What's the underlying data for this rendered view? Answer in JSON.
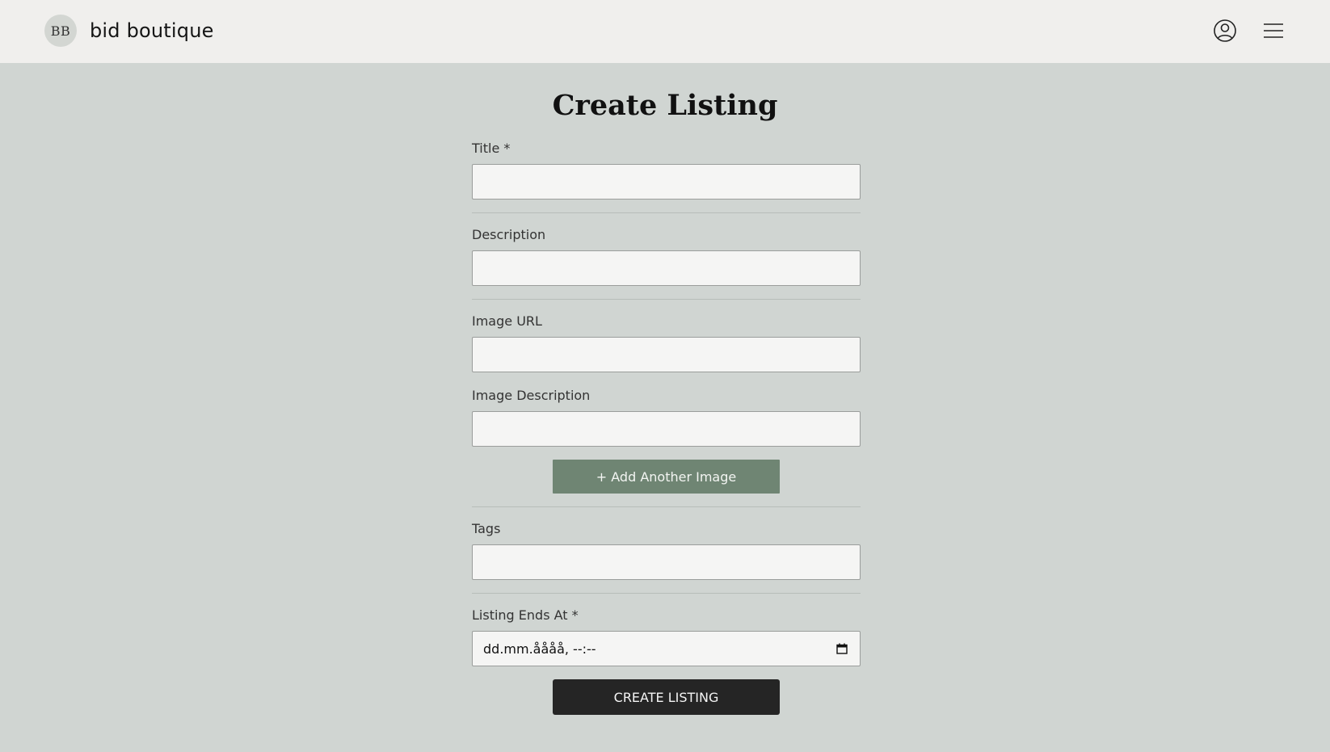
{
  "header": {
    "logo_text": "BB",
    "brand_name": "bid boutique",
    "user_icon": "user-circle-icon",
    "menu_icon": "hamburger-menu-icon"
  },
  "page": {
    "title": "Create Listing"
  },
  "form": {
    "title_label": "Title *",
    "title_value": "",
    "description_label": "Description",
    "description_value": "",
    "image_url_label": "Image URL",
    "image_url_value": "",
    "image_description_label": "Image Description",
    "image_description_value": "",
    "add_image_label": "+ Add Another Image",
    "tags_label": "Tags",
    "tags_value": "",
    "ends_at_label": "Listing Ends At *",
    "ends_at_placeholder": "dd.mm.åååå, --:--",
    "calendar_icon": "calendar-icon",
    "submit_label": "CREATE LISTING"
  },
  "colors": {
    "page_bg": "#d0d5d2",
    "header_bg": "#f0efed",
    "accent_green": "#6f8573",
    "submit_dark": "#252525",
    "input_bg": "#f5f5f4"
  }
}
